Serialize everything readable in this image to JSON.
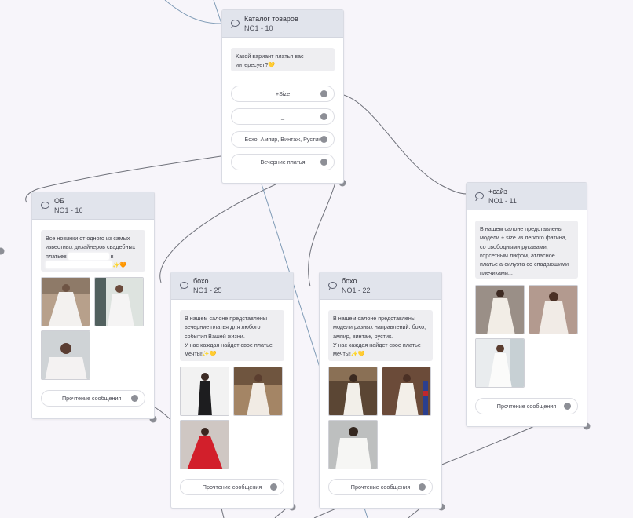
{
  "nodes": {
    "catalog": {
      "title": "Каталог товаров",
      "id": "NO1 - 10",
      "message": "Какой вариант платья вас интересует?💛",
      "buttons": [
        "+Size",
        "_",
        "Бохо, Ампир, Винтаж, Рустик",
        "Вечерние платья"
      ]
    },
    "ob": {
      "title": "ОБ",
      "id": "NO1 - 16",
      "message_line1": "Все новинки от одного из самых",
      "message_line2": "известных дизайнеров свадебных",
      "message_line3_start": "платьев",
      "message_line3_end": "в",
      "message_line4_end": "✨🧡",
      "button": "Прочтение сообщения"
    },
    "boho25": {
      "title": "бохо",
      "id": "NO1 - 25",
      "message": "В нашем салоне представлены вечерние платья для любого события Вашей жизни.\nУ нас каждая найдет свое платье мечты!✨💛",
      "button": "Прочтение сообщения"
    },
    "boho22": {
      "title": "бохо",
      "id": "NO1 - 22",
      "message": "В нашем салоне представлены модели разных направлений: бохо, ампир, винтаж, рустик.\nУ нас каждая найдет свое платье мечты!✨💛",
      "button": "Прочтение сообщения"
    },
    "size": {
      "title": "+сайз",
      "id": "NO1 - 11",
      "message": "В нашем салоне представлены модели + size из легкого фатина, со свободными рукавами, корсетным лифом, атласное платье а-силуэта со спадающими плечиками...",
      "button": "Прочтение сообщения"
    }
  },
  "colors": {
    "canvas": "#f7f5fa",
    "node_header": "#e1e4ec",
    "message_bg": "#eeeef1",
    "connector_dot": "#8d8f96",
    "wire_gray": "#6e7079",
    "wire_blue": "#7f9bb6"
  },
  "icons": {
    "node_header": "chat-bubble-icon"
  }
}
